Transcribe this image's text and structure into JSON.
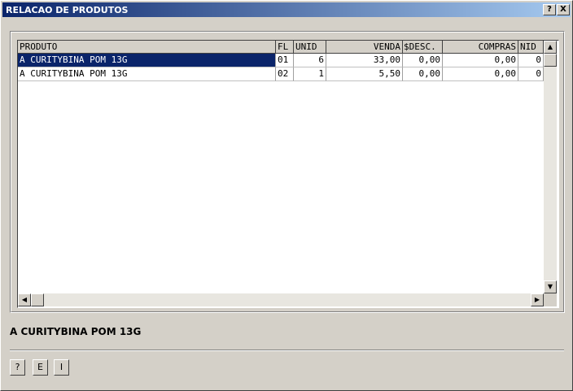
{
  "window": {
    "title": "RELACAO DE PRODUTOS",
    "help_button": "?",
    "close_button": "X"
  },
  "table": {
    "columns": [
      "PRODUTO",
      "FL",
      "UNID",
      "VENDA",
      "$DESC.",
      "COMPRAS",
      "NID"
    ],
    "rows": [
      [
        "A CURITYBINA POM 13G",
        "01",
        "6",
        "33,00",
        "0,00",
        "0,00",
        "0"
      ],
      [
        "A CURITYBINA POM 13G",
        "02",
        "1",
        "5,50",
        "0,00",
        "0,00",
        "0"
      ]
    ],
    "selected_row": 0
  },
  "scrollbars": {
    "up_arrow": "▲",
    "down_arrow": "▼",
    "left_arrow": "◀",
    "right_arrow": "▶"
  },
  "status_text": "A CURITYBINA POM 13G",
  "buttons": {
    "help": "?",
    "e": "E",
    "i": "I"
  },
  "colors": {
    "title_start": "#0a246a",
    "title_end": "#a6caf0",
    "selection": "#0a246a",
    "face": "#d4d0c8"
  }
}
